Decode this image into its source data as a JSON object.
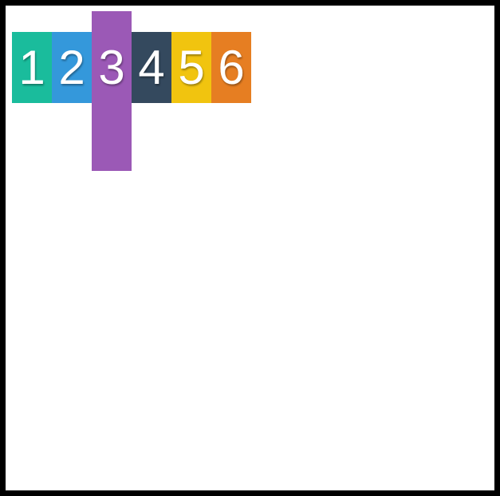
{
  "tiles": [
    {
      "label": "1",
      "color": "#1abc9c"
    },
    {
      "label": "2",
      "color": "#3498db"
    },
    {
      "label": "3",
      "color": "#9b59b6",
      "expanded": true
    },
    {
      "label": "4",
      "color": "#34495e"
    },
    {
      "label": "5",
      "color": "#f1c40f"
    },
    {
      "label": "6",
      "color": "#e67e22"
    }
  ]
}
